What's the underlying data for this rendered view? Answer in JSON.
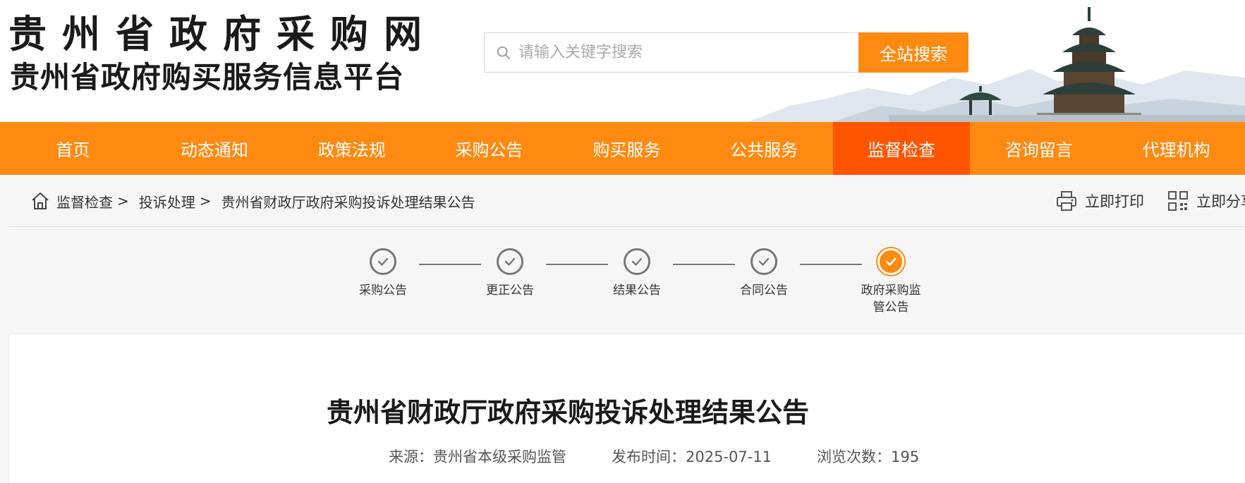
{
  "header": {
    "logo_line1": "贵州省政府采购网",
    "logo_line2": "贵州省政府购买服务信息平台",
    "search_placeholder": "请输入关键字搜索",
    "search_button": "全站搜索"
  },
  "nav": {
    "items": [
      {
        "label": "首页"
      },
      {
        "label": "动态通知"
      },
      {
        "label": "政策法规"
      },
      {
        "label": "采购公告"
      },
      {
        "label": "购买服务"
      },
      {
        "label": "公共服务"
      },
      {
        "label": "监督检查"
      },
      {
        "label": "咨询留言"
      },
      {
        "label": "代理机构"
      }
    ],
    "active": "监督检查"
  },
  "breadcrumb": {
    "items": [
      "监督检查",
      "投诉处理",
      "贵州省财政厅政府采购投诉处理结果公告"
    ],
    "separator": ">"
  },
  "tools": {
    "print": "立即打印",
    "share": "立即分享"
  },
  "steps": [
    {
      "label": "采购公告",
      "state": "done"
    },
    {
      "label": "更正公告",
      "state": "done"
    },
    {
      "label": "结果公告",
      "state": "done"
    },
    {
      "label": "合同公告",
      "state": "done"
    },
    {
      "label": "政府采购监管公告",
      "state": "current"
    }
  ],
  "article": {
    "title": "贵州省财政厅政府采购投诉处理结果公告",
    "source_label": "来源：",
    "source": "贵州省本级采购监管",
    "date_label": "发布时间：",
    "date": "2025-07-11",
    "views_label": "浏览次数：",
    "views": "195"
  },
  "colors": {
    "brand_orange": "#ff8a12",
    "active_orange": "#ff5500"
  }
}
